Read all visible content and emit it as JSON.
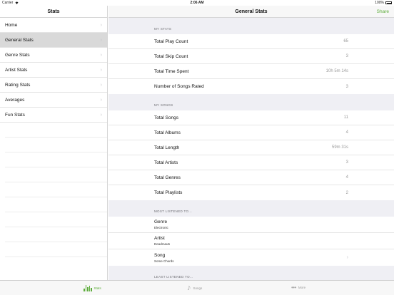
{
  "status_bar": {
    "carrier": "Carrier",
    "time": "2:06 AM",
    "battery": "100%"
  },
  "sidebar": {
    "title": "Stats",
    "items": [
      {
        "label": "Home"
      },
      {
        "label": "General Stats"
      },
      {
        "label": "Genre Stats"
      },
      {
        "label": "Artist Stats"
      },
      {
        "label": "Rating Stats"
      },
      {
        "label": "Averages"
      },
      {
        "label": "Fun Stats"
      }
    ]
  },
  "main": {
    "title": "General Stats",
    "share_label": "Share",
    "my_stats": {
      "header": "MY STATS",
      "rows": [
        {
          "label": "Total Play Count",
          "value": "65"
        },
        {
          "label": "Total Skip Count",
          "value": "3"
        },
        {
          "label": "Total Time Spent",
          "value": "10h 5m 14s"
        },
        {
          "label": "Number of Songs Rated",
          "value": "3"
        }
      ]
    },
    "my_songs": {
      "header": "MY SONGS",
      "rows": [
        {
          "label": "Total Songs",
          "value": "11"
        },
        {
          "label": "Total Albums",
          "value": "4"
        },
        {
          "label": "Total Length",
          "value": "59m 31s"
        },
        {
          "label": "Total Artists",
          "value": "3"
        },
        {
          "label": "Total Genres",
          "value": "4"
        },
        {
          "label": "Total Playlists",
          "value": "2"
        }
      ]
    },
    "most_listened": {
      "header": "MOST LISTENED TO...",
      "rows": [
        {
          "title": "Genre",
          "subtitle": "Electronic"
        },
        {
          "title": "Artist",
          "subtitle": "Deadmau5"
        },
        {
          "title": "Song",
          "subtitle": "Some Chords"
        }
      ]
    },
    "least_listened": {
      "header": "LEAST LISTENED TO..."
    }
  },
  "tabbar": {
    "stats": "Stats",
    "songs": "Songs",
    "more": "More",
    "accent": "#5cac3a"
  },
  "icons": [
    "wifi-icon",
    "battery-icon",
    "chevron-right-icon",
    "bar-chart-icon",
    "music-note-icon",
    "more-dots-icon"
  ]
}
